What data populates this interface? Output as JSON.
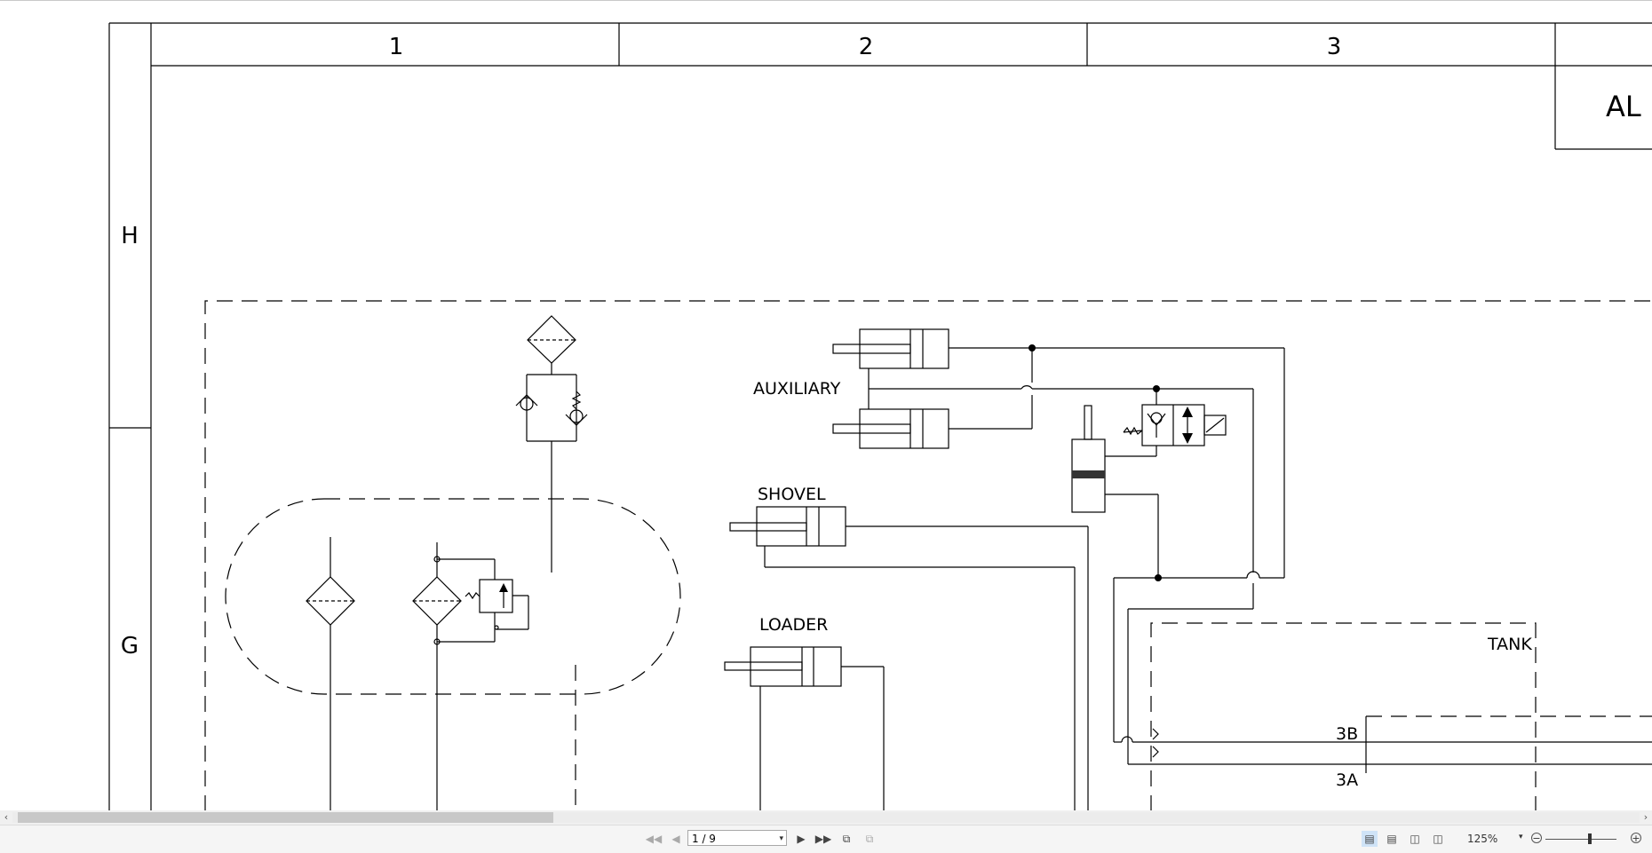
{
  "drawing": {
    "column_labels": [
      "1",
      "2",
      "3"
    ],
    "row_labels": [
      "H",
      "G"
    ],
    "title_block_text": "AL",
    "component_labels": {
      "auxiliary": "AUXILIARY",
      "shovel": "SHOVEL",
      "loader": "LOADER",
      "tank": "TANK",
      "port_3b": "3B",
      "port_3a": "3A"
    }
  },
  "toolbar": {
    "page_indicator": "1 / 9",
    "zoom_level": "125%"
  },
  "icons": {
    "first_page": "first-page-icon",
    "prev_page": "previous-page-icon",
    "next_page": "next-page-icon",
    "last_page": "last-page-icon",
    "zoom_out": "zoom-out-icon",
    "zoom_in": "zoom-in-icon"
  }
}
